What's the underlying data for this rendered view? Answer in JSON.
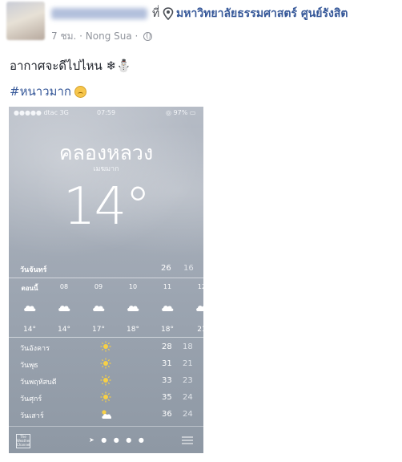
{
  "post": {
    "was_at": "ที่",
    "place": "มหาวิทยาลัยธรรมศาสตร์ ศูนย์รังสิต",
    "time": "7 ชม.",
    "separator": " · ",
    "location": "Nong Sua",
    "dot": " · ",
    "text": "อากาศจะดีไปไหน ❄⛄",
    "hashtag": "#หนาวมาก"
  },
  "weather": {
    "status": {
      "carrier": "●●●●● dtac  3G",
      "time": "07:59",
      "battery": "◎ 97% ▭"
    },
    "city": "คลองหลวง",
    "condition": "เมฆมาก",
    "temperature": "14°",
    "today": {
      "day": "วันจันทร์",
      "high": "26",
      "low": "16"
    },
    "hourly": [
      {
        "label": "ตอนนี้",
        "temp": "14°",
        "icon": "cloud-icon"
      },
      {
        "label": "08",
        "temp": "14°",
        "icon": "cloud-icon"
      },
      {
        "label": "09",
        "temp": "17°",
        "icon": "cloud-icon"
      },
      {
        "label": "10",
        "temp": "18°",
        "icon": "cloud-icon"
      },
      {
        "label": "11",
        "temp": "18°",
        "icon": "cloud-icon"
      },
      {
        "label": "12",
        "temp": "21",
        "icon": "cloud-icon"
      }
    ],
    "daily": [
      {
        "day": "วันอังคาร",
        "high": "28",
        "low": "18",
        "icon": "sun-icon"
      },
      {
        "day": "วันพุธ",
        "high": "31",
        "low": "21",
        "icon": "sun-icon"
      },
      {
        "day": "วันพฤหัสบดี",
        "high": "33",
        "low": "23",
        "icon": "sun-icon"
      },
      {
        "day": "วันศุกร์",
        "high": "35",
        "low": "24",
        "icon": "sun-icon"
      },
      {
        "day": "วันเสาร์",
        "high": "36",
        "low": "24",
        "icon": "partly-cloudy-icon"
      }
    ],
    "footer": {
      "logo_text": "The Weather Channel",
      "pager": "➤ ● ● ● ●"
    }
  },
  "colors": {
    "link": "#365899",
    "meta": "#90949c",
    "text": "#1d2129"
  }
}
